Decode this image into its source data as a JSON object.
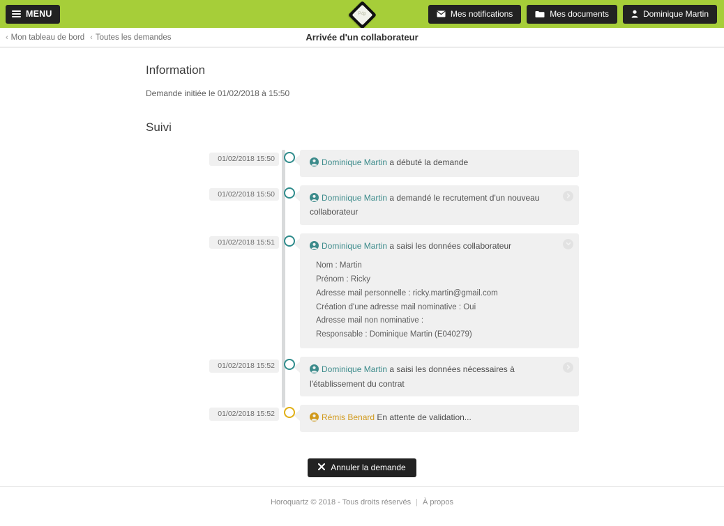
{
  "header": {
    "menu_label": "MENU",
    "brand_color": "#a6ce39",
    "dark_color": "#222222",
    "logo_text": "P4p",
    "buttons": [
      {
        "label": "Mes notifications",
        "icon": "envelope-icon"
      },
      {
        "label": "Mes documents",
        "icon": "folder-icon"
      },
      {
        "label": "Dominique Martin",
        "icon": "user-icon"
      }
    ]
  },
  "breadcrumb": {
    "items": [
      {
        "label": "Mon tableau de bord",
        "sep": "‹"
      },
      {
        "label": "Toutes les demandes",
        "sep": "‹"
      }
    ]
  },
  "page_title": "Arrivée d'un collaborateur",
  "sections": {
    "information_title": "Information",
    "information_line": "Demande initiée le 01/02/2018 à 15:50",
    "suivi_title": "Suivi"
  },
  "timeline": {
    "accent_color": "#3c8b8b",
    "pending_color": "#d19a1c",
    "entries": [
      {
        "date": "01/02/2018 15:50",
        "actor": "Dominique Martin",
        "text": " a débuté la demande",
        "state": "done",
        "chevron": "none",
        "details": []
      },
      {
        "date": "01/02/2018 15:50",
        "actor": "Dominique Martin",
        "text": " a demandé le recrutement d'un nouveau collaborateur",
        "state": "done",
        "chevron": "right",
        "details": []
      },
      {
        "date": "01/02/2018 15:51",
        "actor": "Dominique Martin",
        "text": " a saisi les données collaborateur",
        "state": "done",
        "chevron": "down",
        "details": [
          "Nom : Martin",
          "Prénom : Ricky",
          "Adresse mail personnelle : ricky.martin@gmail.com",
          "Création d'une adresse mail nominative : Oui",
          "Adresse mail non nominative :",
          "Responsable : Dominique Martin (E040279)"
        ]
      },
      {
        "date": "01/02/2018 15:52",
        "actor": "Dominique Martin",
        "text": " a saisi les données nécessaires à l'établissement du contrat",
        "state": "done",
        "chevron": "right",
        "details": []
      },
      {
        "date": "01/02/2018 15:52",
        "actor": "Rémis Benard",
        "text": " En attente de validation...",
        "state": "pending",
        "chevron": "none",
        "details": []
      }
    ]
  },
  "cancel_button": {
    "label": "Annuler la demande",
    "icon": "close-x-icon"
  },
  "footer": {
    "copyright": "Horoquartz © 2018 - Tous droits réservés",
    "separator": "|",
    "about_label": "À propos"
  }
}
